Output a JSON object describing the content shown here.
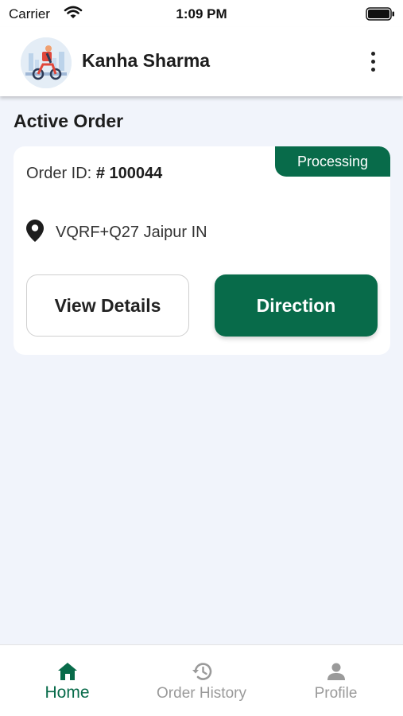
{
  "status_bar": {
    "carrier": "Carrier",
    "time": "1:09 PM"
  },
  "header": {
    "user_name": "Kanha Sharma",
    "avatar_icon": "delivery-scooter-avatar",
    "menu_icon": "more-vertical-icon"
  },
  "main": {
    "section_title": "Active Order",
    "order": {
      "status": "Processing",
      "order_id_label": "Order ID:",
      "order_id_value": "# 100044",
      "location_icon": "map-pin-icon",
      "address": "VQRF+Q27 Jaipur IN",
      "view_details_label": "View Details",
      "direction_label": "Direction"
    }
  },
  "bottom_nav": {
    "items": [
      {
        "label": "Home",
        "icon": "home-icon",
        "active": true
      },
      {
        "label": "Order History",
        "icon": "history-icon",
        "active": false
      },
      {
        "label": "Profile",
        "icon": "user-icon",
        "active": false
      }
    ]
  },
  "colors": {
    "primary": "#086b4a",
    "background": "#f1f4fb",
    "inactive": "#9a9a9a"
  }
}
